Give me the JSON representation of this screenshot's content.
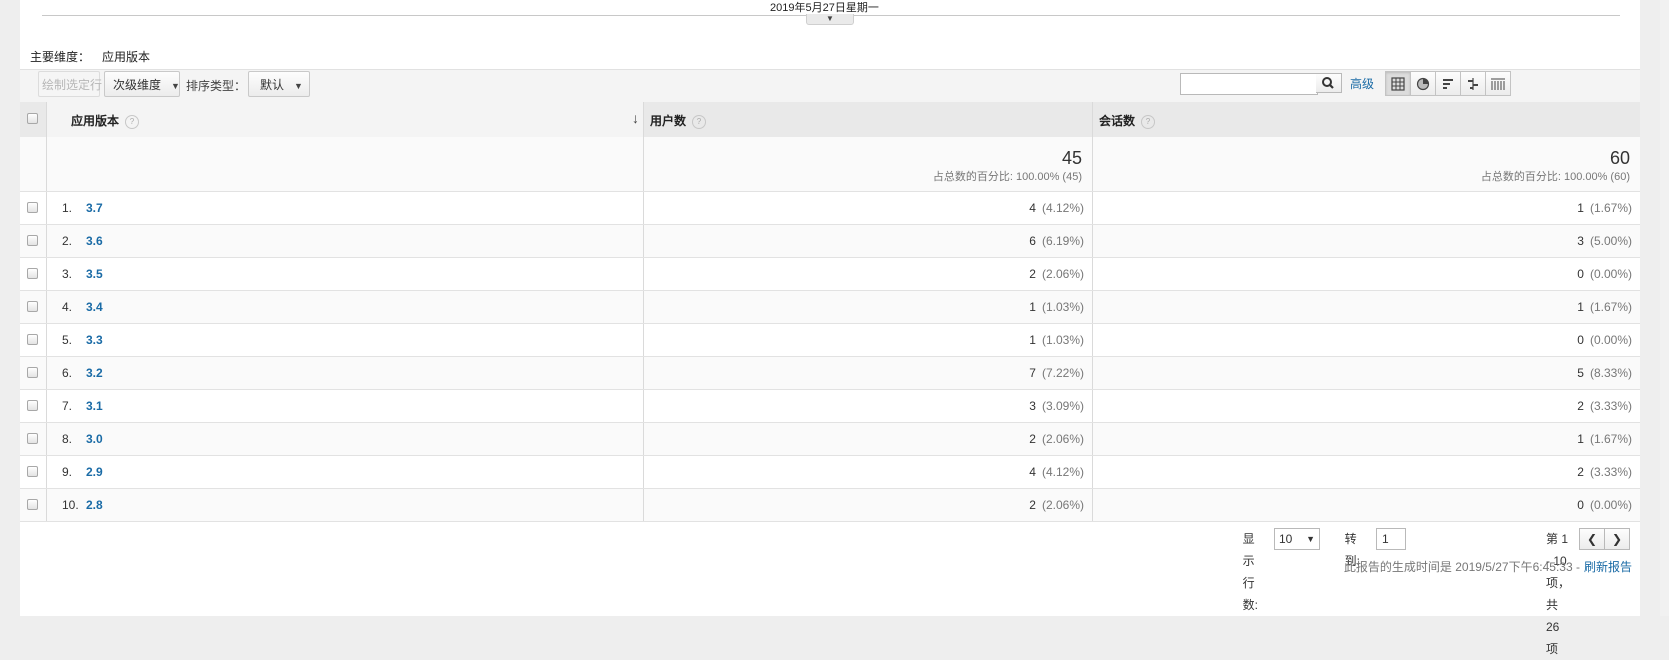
{
  "timeline": {
    "date_label": "2019年5月27日星期一"
  },
  "primary_dimension": {
    "label": "主要维度：",
    "value": "应用版本"
  },
  "toolbar": {
    "plot_rows": "绘制选定行",
    "secondary_dimension": "次级维度",
    "sort_type_label": "排序类型：",
    "sort_type_value": "默认",
    "search_value": "",
    "advanced": "高级"
  },
  "table": {
    "headers": {
      "dimension": "应用版本",
      "users": "用户数",
      "sessions": "会话数"
    },
    "totals": {
      "users": "45",
      "users_sub": "占总数的百分比: 100.00% (45)",
      "sessions": "60",
      "sessions_sub": "占总数的百分比: 100.00% (60)"
    },
    "rows": [
      {
        "rank": "1.",
        "version": "3.7",
        "users": "4",
        "users_pct": "(4.12%)",
        "sessions": "1",
        "sessions_pct": "(1.67%)"
      },
      {
        "rank": "2.",
        "version": "3.6",
        "users": "6",
        "users_pct": "(6.19%)",
        "sessions": "3",
        "sessions_pct": "(5.00%)"
      },
      {
        "rank": "3.",
        "version": "3.5",
        "users": "2",
        "users_pct": "(2.06%)",
        "sessions": "0",
        "sessions_pct": "(0.00%)"
      },
      {
        "rank": "4.",
        "version": "3.4",
        "users": "1",
        "users_pct": "(1.03%)",
        "sessions": "1",
        "sessions_pct": "(1.67%)"
      },
      {
        "rank": "5.",
        "version": "3.3",
        "users": "1",
        "users_pct": "(1.03%)",
        "sessions": "0",
        "sessions_pct": "(0.00%)"
      },
      {
        "rank": "6.",
        "version": "3.2",
        "users": "7",
        "users_pct": "(7.22%)",
        "sessions": "5",
        "sessions_pct": "(8.33%)"
      },
      {
        "rank": "7.",
        "version": "3.1",
        "users": "3",
        "users_pct": "(3.09%)",
        "sessions": "2",
        "sessions_pct": "(3.33%)"
      },
      {
        "rank": "8.",
        "version": "3.0",
        "users": "2",
        "users_pct": "(2.06%)",
        "sessions": "1",
        "sessions_pct": "(1.67%)"
      },
      {
        "rank": "9.",
        "version": "2.9",
        "users": "4",
        "users_pct": "(4.12%)",
        "sessions": "2",
        "sessions_pct": "(3.33%)"
      },
      {
        "rank": "10.",
        "version": "2.8",
        "users": "2",
        "users_pct": "(2.06%)",
        "sessions": "0",
        "sessions_pct": "(0.00%)"
      }
    ]
  },
  "pagination": {
    "rows_label": "显示行数:",
    "rows_value": "10",
    "goto_label": "转到:",
    "goto_value": "1",
    "range_text": "第 1 - 10 项，共 26 项",
    "prev": "❮",
    "next": "❯"
  },
  "footer": {
    "generated": "此报告的生成时间是 2019/5/27下午6:45:33 -",
    "refresh": "刷新报告"
  },
  "colors": {
    "link": "#1a6ba6",
    "header_bg": "#e9e9e9",
    "alt_row": "#fafafa"
  }
}
